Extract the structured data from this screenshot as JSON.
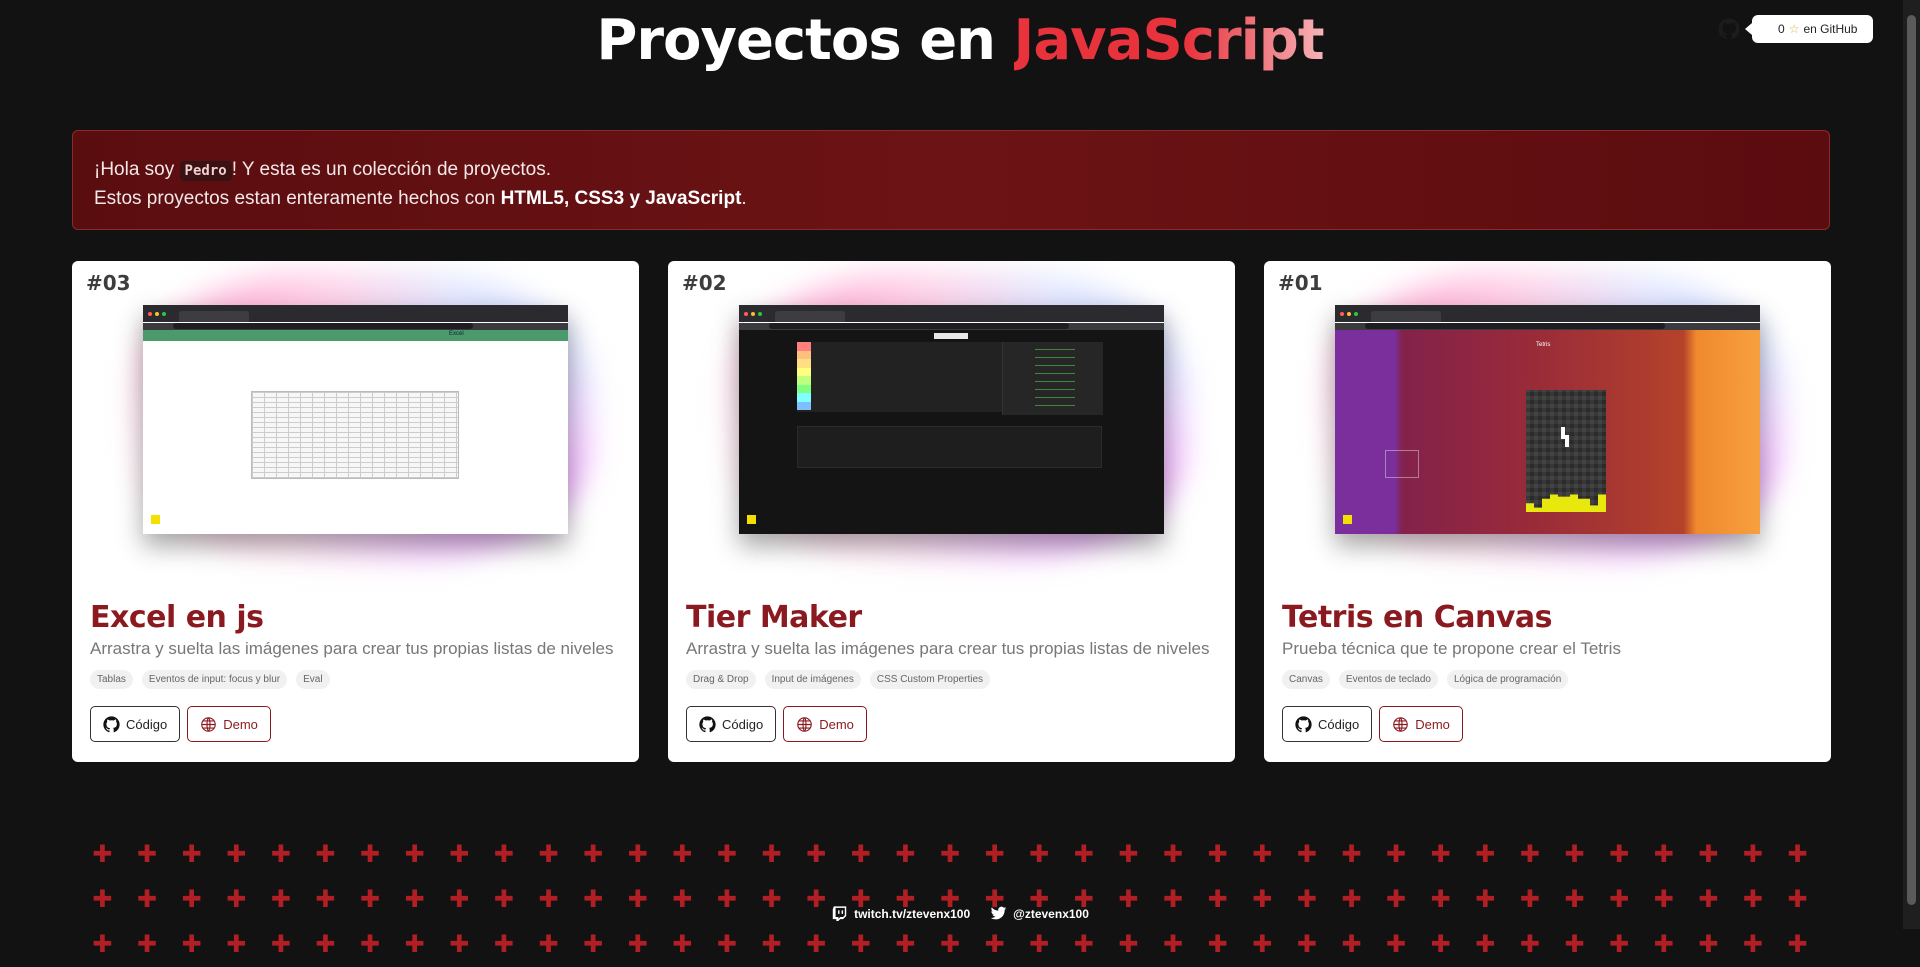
{
  "header": {
    "title_prefix": "Proyectos en",
    "title_highlight": "JavaScript",
    "github_stars": "0",
    "github_label": "en GitHub"
  },
  "intro": {
    "greeting_before": "¡Hola soy",
    "name": "Pedro",
    "greeting_after": "! Y esta es un colección de proyectos.",
    "line2_before": "Estos proyectos estan enteramente hechos con",
    "line2_tech": "HTML5, CSS3 y JavaScript",
    "line2_after": "."
  },
  "projects": [
    {
      "number": "#03",
      "title": "Excel en js",
      "description": "Arrastra y suelta las imágenes para crear tus propias listas de niveles",
      "tags": [
        "Tablas",
        "Eventos de input: focus y blur",
        "Eval"
      ],
      "code_label": "Código",
      "demo_label": "Demo",
      "preview_label": "Excel"
    },
    {
      "number": "#02",
      "title": "Tier Maker",
      "description": "Arrastra y suelta las imágenes para crear tus propias listas de niveles",
      "tags": [
        "Drag & Drop",
        "Input de imágenes",
        "CSS Custom Properties"
      ],
      "code_label": "Código",
      "demo_label": "Demo"
    },
    {
      "number": "#01",
      "title": "Tetris en Canvas",
      "description": "Prueba técnica que te propone crear el Tetris",
      "tags": [
        "Canvas",
        "Eventos de teclado",
        "Lógica de programación"
      ],
      "code_label": "Código",
      "demo_label": "Demo",
      "preview_label": "Tetris"
    }
  ],
  "footer": {
    "twitch": "twitch.tv/ztevenx100",
    "twitter": "@ztevenx100"
  },
  "colors": {
    "accent": "#8a1a1f",
    "highlight": "#e8323c",
    "background": "#131213",
    "intro_bg": "#6c1315"
  },
  "icons": {
    "github": "github-icon",
    "star": "star-icon",
    "globe": "globe-icon",
    "twitch": "twitch-icon",
    "twitter": "twitter-icon",
    "plus": "plus-icon"
  }
}
